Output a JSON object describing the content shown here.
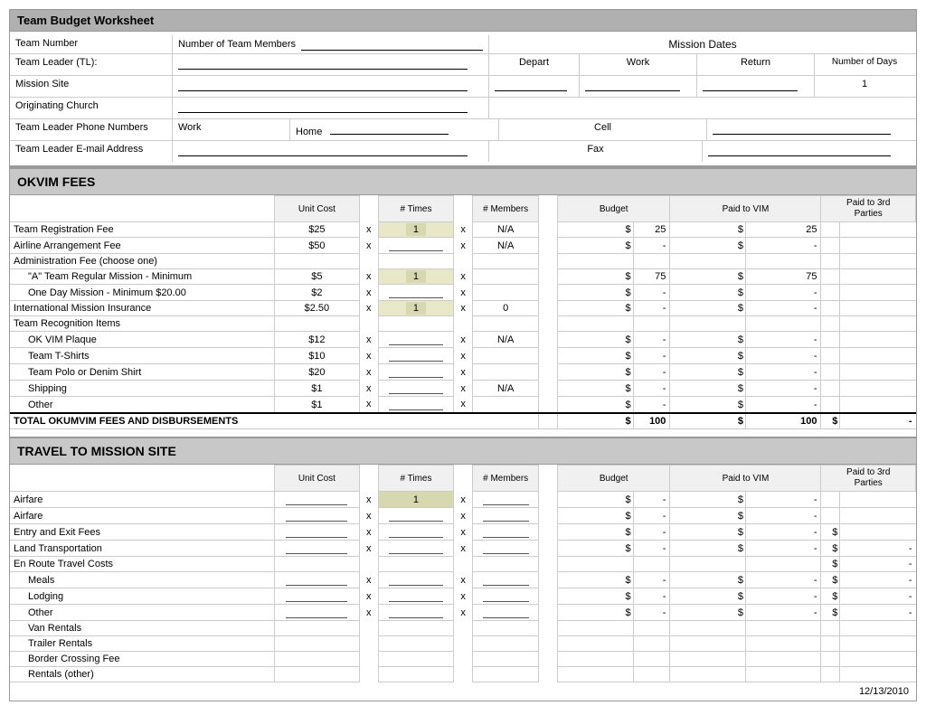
{
  "title": "Team Budget Worksheet",
  "header": {
    "team_number_label": "Team Number",
    "num_members_label": "Number of Team Members",
    "mission_dates_label": "Mission  Dates",
    "team_leader_label": "Team Leader (TL):",
    "depart_label": "Depart",
    "work_label": "Work",
    "return_label": "Return",
    "num_days_label": "Number of Days",
    "num_days_value": "1",
    "mission_site_label": "Mission Site",
    "orig_church_label": "Originating Church",
    "phone_label": "Team Leader Phone Numbers",
    "work_label2": "Work",
    "home_label": "Home",
    "cell_label": "Cell",
    "email_label": "Team Leader E-mail Address",
    "fax_label": "Fax"
  },
  "okvim": {
    "section_title": "OKVIM FEES",
    "col_unit": "Unit Cost",
    "col_times": "# Times",
    "col_members": "# Members",
    "col_budget": "Budget",
    "col_vim": "Paid to VIM",
    "col_3rd": "Paid to 3rd Parties",
    "rows": [
      {
        "desc": "Team Registration Fee",
        "unit": "$25",
        "times": "1",
        "members": "N/A",
        "budget_dollar": "$",
        "budget_val": "25",
        "vim_dollar": "$",
        "vim_val": "25",
        "third_dollar": "",
        "third_val": ""
      },
      {
        "desc": "Airline Arrangement Fee",
        "unit": "$50",
        "times": "",
        "members": "N/A",
        "budget_dollar": "$",
        "budget_val": "-",
        "vim_dollar": "$",
        "vim_val": "-",
        "third_dollar": "",
        "third_val": ""
      },
      {
        "desc": "Administration Fee (choose one)",
        "unit": "",
        "times": "",
        "members": "",
        "budget_dollar": "",
        "budget_val": "",
        "vim_dollar": "",
        "vim_val": "",
        "third_dollar": "",
        "third_val": ""
      },
      {
        "desc": "\"A\" Team Regular   Mission - Minimum",
        "unit": "$5",
        "times": "1",
        "members": "",
        "budget_dollar": "$",
        "budget_val": "75",
        "vim_dollar": "$",
        "vim_val": "75",
        "third_dollar": "",
        "third_val": ""
      },
      {
        "desc": "  One Day Mission - Minimum $20.00",
        "unit": "$2",
        "times": "",
        "members": "",
        "budget_dollar": "$",
        "budget_val": "-",
        "vim_dollar": "$",
        "vim_val": "-",
        "third_dollar": "",
        "third_val": ""
      },
      {
        "desc": "International Mission Insurance",
        "unit": "$2.50",
        "times": "1",
        "members": "0",
        "budget_dollar": "$",
        "budget_val": "-",
        "vim_dollar": "$",
        "vim_val": "-",
        "third_dollar": "",
        "third_val": ""
      },
      {
        "desc": "Team Recognition Items",
        "unit": "",
        "times": "",
        "members": "",
        "budget_dollar": "",
        "budget_val": "",
        "vim_dollar": "",
        "vim_val": "",
        "third_dollar": "",
        "third_val": ""
      },
      {
        "desc": "  OK VIM Plaque",
        "unit": "$12",
        "times": "",
        "members": "N/A",
        "budget_dollar": "$",
        "budget_val": "-",
        "vim_dollar": "$",
        "vim_val": "-",
        "third_dollar": "",
        "third_val": ""
      },
      {
        "desc": "  Team T-Shirts",
        "unit": "$10",
        "times": "",
        "members": "",
        "budget_dollar": "$",
        "budget_val": "-",
        "vim_dollar": "$",
        "vim_val": "-",
        "third_dollar": "",
        "third_val": ""
      },
      {
        "desc": "  Team Polo or Denim Shirt",
        "unit": "$20",
        "times": "",
        "members": "",
        "budget_dollar": "$",
        "budget_val": "-",
        "vim_dollar": "$",
        "vim_val": "-",
        "third_dollar": "",
        "third_val": ""
      },
      {
        "desc": "  Shipping",
        "unit": "$1",
        "times": "",
        "members": "N/A",
        "budget_dollar": "$",
        "budget_val": "-",
        "vim_dollar": "$",
        "vim_val": "-",
        "third_dollar": "",
        "third_val": ""
      },
      {
        "desc": "  Other",
        "unit": "$1",
        "times": "",
        "members": "",
        "budget_dollar": "$",
        "budget_val": "-",
        "vim_dollar": "$",
        "vim_val": "-",
        "third_dollar": "",
        "third_val": ""
      }
    ],
    "total_label": "TOTAL OKUMVIM FEES AND DISBURSEMENTS",
    "total_budget_dollar": "$",
    "total_budget_val": "100",
    "total_vim_dollar": "$",
    "total_vim_val": "100",
    "total_3rd_dollar": "$",
    "total_3rd_val": "-"
  },
  "travel": {
    "section_title": "TRAVEL TO MISSION SITE",
    "col_unit": "Unit Cost",
    "col_times": "# Times",
    "col_members": "# Members",
    "col_budget": "Budget",
    "col_vim": "Paid to VIM",
    "col_3rd": "Paid to 3rd Parties",
    "rows": [
      {
        "desc": "Airfare",
        "unit": "",
        "times": "1",
        "members": "",
        "budget_dollar": "$",
        "budget_val": "-",
        "vim_dollar": "$",
        "vim_val": "-",
        "third_dollar": "",
        "third_val": ""
      },
      {
        "desc": "Airfare",
        "unit": "",
        "times": "",
        "members": "",
        "budget_dollar": "$",
        "budget_val": "-",
        "vim_dollar": "$",
        "vim_val": "-",
        "third_dollar": "",
        "third_val": ""
      },
      {
        "desc": "Entry and Exit Fees",
        "unit": "",
        "times": "",
        "members": "",
        "budget_dollar": "$",
        "budget_val": "-",
        "vim_dollar": "$",
        "vim_val": "-",
        "third_dollar": "$",
        "third_val": ""
      },
      {
        "desc": "Land Transportation",
        "unit": "",
        "times": "",
        "members": "",
        "budget_dollar": "$",
        "budget_val": "-",
        "vim_dollar": "$",
        "vim_val": "-",
        "third_dollar": "$",
        "third_val": "-"
      },
      {
        "desc": "En Route Travel Costs",
        "unit": "",
        "times": "",
        "members": "",
        "budget_dollar": "",
        "budget_val": "",
        "vim_dollar": "",
        "vim_val": "",
        "third_dollar": "$",
        "third_val": "-"
      },
      {
        "desc": "  Meals",
        "unit": "",
        "times": "",
        "members": "",
        "budget_dollar": "$",
        "budget_val": "-",
        "vim_dollar": "$",
        "vim_val": "-",
        "third_dollar": "$",
        "third_val": "-"
      },
      {
        "desc": "  Lodging",
        "unit": "",
        "times": "",
        "members": "",
        "budget_dollar": "$",
        "budget_val": "-",
        "vim_dollar": "$",
        "vim_val": "-",
        "third_dollar": "$",
        "third_val": "-"
      },
      {
        "desc": "  Other",
        "unit": "",
        "times": "",
        "members": "",
        "budget_dollar": "$",
        "budget_val": "-",
        "vim_dollar": "$",
        "vim_val": "-",
        "third_dollar": "$",
        "third_val": "-"
      },
      {
        "desc": "  Van Rentals",
        "unit": "",
        "times": "",
        "members": "",
        "budget_dollar": "",
        "budget_val": "",
        "vim_dollar": "",
        "vim_val": "",
        "third_dollar": "",
        "third_val": ""
      },
      {
        "desc": "  Trailer Rentals",
        "unit": "",
        "times": "",
        "members": "",
        "budget_dollar": "",
        "budget_val": "",
        "vim_dollar": "",
        "vim_val": "",
        "third_dollar": "",
        "third_val": ""
      },
      {
        "desc": "  Border Crossing Fee",
        "unit": "",
        "times": "",
        "members": "",
        "budget_dollar": "",
        "budget_val": "",
        "vim_dollar": "",
        "vim_val": "",
        "third_dollar": "",
        "third_val": ""
      },
      {
        "desc": "  Rentals (other)",
        "unit": "",
        "times": "",
        "members": "",
        "budget_dollar": "",
        "budget_val": "",
        "vim_dollar": "",
        "vim_val": "",
        "third_dollar": "",
        "third_val": ""
      }
    ]
  },
  "footer": {
    "date": "12/13/2010"
  }
}
